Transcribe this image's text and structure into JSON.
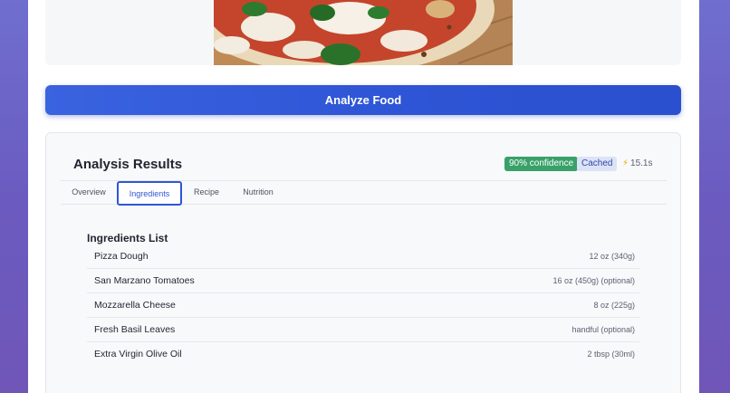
{
  "image": {
    "subject": "margherita pizza"
  },
  "actions": {
    "analyze_label": "Analyze Food"
  },
  "results": {
    "title": "Analysis Results",
    "confidence": "90% confidence",
    "cached": "Cached",
    "time_icon": "lightning-icon",
    "time": "15.1s"
  },
  "tabs": [
    {
      "label": "Overview",
      "active": false
    },
    {
      "label": "Ingredients",
      "active": true
    },
    {
      "label": "Recipe",
      "active": false
    },
    {
      "label": "Nutrition",
      "active": false
    }
  ],
  "ingredients": {
    "title": "Ingredients List",
    "items": [
      {
        "name": "Pizza Dough",
        "quantity": "12 oz (340g)"
      },
      {
        "name": "San Marzano Tomatoes",
        "quantity": "16 oz (450g) (optional)"
      },
      {
        "name": "Mozzarella Cheese",
        "quantity": "8 oz (225g)"
      },
      {
        "name": "Fresh Basil Leaves",
        "quantity": "handful (optional)"
      },
      {
        "name": "Extra Virgin Olive Oil",
        "quantity": "2 tbsp (30ml)"
      }
    ]
  },
  "colors": {
    "accent": "#2f56d6",
    "confidence_badge": "#38a169",
    "cached_badge": "#dde3f7"
  }
}
